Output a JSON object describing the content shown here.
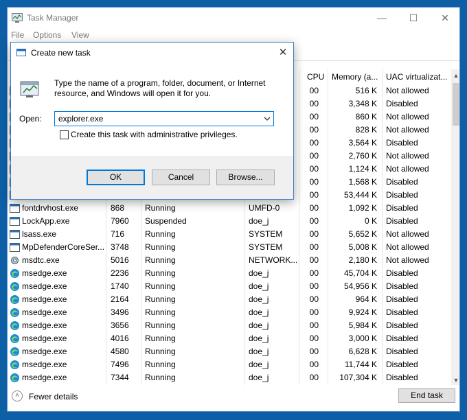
{
  "window": {
    "title": "Task Manager",
    "minimize": "—",
    "maximize": "☐",
    "close": "✕"
  },
  "menu": [
    "File",
    "Options",
    "View"
  ],
  "columns": {
    "cpu": "CPU",
    "memory": "Memory (a...",
    "uac": "UAC virtualizat..."
  },
  "rows": [
    {
      "name": "",
      "pid": "",
      "status": "",
      "user": "",
      "cpu": "00",
      "mem": "516 K",
      "uac": "Not allowed",
      "icon": "app-icon"
    },
    {
      "name": "",
      "pid": "",
      "status": "",
      "user": "",
      "cpu": "00",
      "mem": "3,348 K",
      "uac": "Disabled",
      "icon": "app-icon"
    },
    {
      "name": "",
      "pid": "",
      "status": "",
      "user": "",
      "cpu": "00",
      "mem": "860 K",
      "uac": "Not allowed",
      "icon": "app-icon"
    },
    {
      "name": "",
      "pid": "",
      "status": "",
      "user": "",
      "cpu": "00",
      "mem": "828 K",
      "uac": "Not allowed",
      "icon": "app-icon"
    },
    {
      "name": "",
      "pid": "",
      "status": "",
      "user": "",
      "cpu": "00",
      "mem": "3,564 K",
      "uac": "Disabled",
      "icon": "app-icon"
    },
    {
      "name": "",
      "pid": "",
      "status": "",
      "user": "",
      "cpu": "00",
      "mem": "2,760 K",
      "uac": "Not allowed",
      "icon": "app-icon"
    },
    {
      "name": "",
      "pid": "",
      "status": "",
      "user": "",
      "cpu": "00",
      "mem": "1,124 K",
      "uac": "Not allowed",
      "icon": "app-icon"
    },
    {
      "name": "",
      "pid": "",
      "status": "",
      "user": "",
      "cpu": "00",
      "mem": "1,568 K",
      "uac": "Disabled",
      "icon": "app-icon"
    },
    {
      "name": "",
      "pid": "",
      "status": "",
      "user": "",
      "cpu": "00",
      "mem": "53,444 K",
      "uac": "Disabled",
      "icon": "app-icon"
    },
    {
      "name": "fontdrvhost.exe",
      "pid": "868",
      "status": "Running",
      "user": "UMFD-0",
      "cpu": "00",
      "mem": "1,092 K",
      "uac": "Disabled",
      "icon": "app-icon"
    },
    {
      "name": "LockApp.exe",
      "pid": "7960",
      "status": "Suspended",
      "user": "doe_j",
      "cpu": "00",
      "mem": "0 K",
      "uac": "Disabled",
      "icon": "app-icon"
    },
    {
      "name": "lsass.exe",
      "pid": "716",
      "status": "Running",
      "user": "SYSTEM",
      "cpu": "00",
      "mem": "5,652 K",
      "uac": "Not allowed",
      "icon": "app-icon"
    },
    {
      "name": "MpDefenderCoreSer...",
      "pid": "3748",
      "status": "Running",
      "user": "SYSTEM",
      "cpu": "00",
      "mem": "5,008 K",
      "uac": "Not allowed",
      "icon": "app-icon"
    },
    {
      "name": "msdtc.exe",
      "pid": "5016",
      "status": "Running",
      "user": "NETWORK...",
      "cpu": "00",
      "mem": "2,180 K",
      "uac": "Not allowed",
      "icon": "gear-icon"
    },
    {
      "name": "msedge.exe",
      "pid": "2236",
      "status": "Running",
      "user": "doe_j",
      "cpu": "00",
      "mem": "45,704 K",
      "uac": "Disabled",
      "icon": "edge-icon"
    },
    {
      "name": "msedge.exe",
      "pid": "1740",
      "status": "Running",
      "user": "doe_j",
      "cpu": "00",
      "mem": "54,956 K",
      "uac": "Disabled",
      "icon": "edge-icon"
    },
    {
      "name": "msedge.exe",
      "pid": "2164",
      "status": "Running",
      "user": "doe_j",
      "cpu": "00",
      "mem": "964 K",
      "uac": "Disabled",
      "icon": "edge-icon"
    },
    {
      "name": "msedge.exe",
      "pid": "3496",
      "status": "Running",
      "user": "doe_j",
      "cpu": "00",
      "mem": "9,924 K",
      "uac": "Disabled",
      "icon": "edge-icon"
    },
    {
      "name": "msedge.exe",
      "pid": "3656",
      "status": "Running",
      "user": "doe_j",
      "cpu": "00",
      "mem": "5,984 K",
      "uac": "Disabled",
      "icon": "edge-icon"
    },
    {
      "name": "msedge.exe",
      "pid": "4016",
      "status": "Running",
      "user": "doe_j",
      "cpu": "00",
      "mem": "3,000 K",
      "uac": "Disabled",
      "icon": "edge-icon"
    },
    {
      "name": "msedge.exe",
      "pid": "4580",
      "status": "Running",
      "user": "doe_j",
      "cpu": "00",
      "mem": "6,628 K",
      "uac": "Disabled",
      "icon": "edge-icon"
    },
    {
      "name": "msedge.exe",
      "pid": "7496",
      "status": "Running",
      "user": "doe_j",
      "cpu": "00",
      "mem": "11,744 K",
      "uac": "Disabled",
      "icon": "edge-icon"
    },
    {
      "name": "msedge.exe",
      "pid": "7344",
      "status": "Running",
      "user": "doe_j",
      "cpu": "00",
      "mem": "107,304 K",
      "uac": "Disabled",
      "icon": "edge-icon"
    }
  ],
  "footer": {
    "fewer_details": "Fewer details",
    "end_task": "End task"
  },
  "dialog": {
    "title": "Create new task",
    "description": "Type the name of a program, folder, document, or Internet resource, and Windows will open it for you.",
    "open_label": "Open:",
    "open_value": "explorer.exe",
    "admin_label": "Create this task with administrative privileges.",
    "admin_checked": false,
    "ok": "OK",
    "cancel": "Cancel",
    "browse": "Browse...",
    "close": "✕"
  },
  "colors": {
    "desktop": "#0d5fa6",
    "accent": "#0078d7",
    "edge": "#1b8ad8"
  }
}
